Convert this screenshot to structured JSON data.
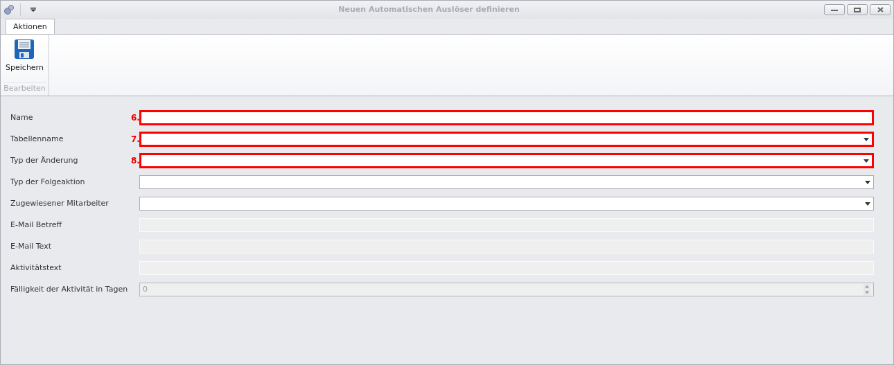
{
  "window": {
    "title": "Neuen Automatischen Auslöser definieren"
  },
  "tabs": [
    {
      "label": "Aktionen",
      "selected": true
    }
  ],
  "ribbon": {
    "buttons": [
      {
        "label": "Speichern"
      }
    ],
    "group": "Bearbeiten"
  },
  "fields": [
    {
      "label": "Name",
      "kind": "text",
      "disabled": false,
      "annotation": "6."
    },
    {
      "label": "Tabellenname",
      "kind": "combo",
      "disabled": false,
      "annotation": "7."
    },
    {
      "label": "Typ der Änderung",
      "kind": "combo",
      "disabled": false,
      "annotation": "8."
    },
    {
      "label": "Typ der Folgeaktion",
      "kind": "combo",
      "disabled": false
    },
    {
      "label": "Zugewiesener Mitarbeiter",
      "kind": "combo",
      "disabled": false
    },
    {
      "label": "E-Mail Betreff",
      "kind": "text",
      "disabled": true
    },
    {
      "label": "E-Mail Text",
      "kind": "text",
      "disabled": true
    },
    {
      "label": "Aktivitätstext",
      "kind": "text",
      "disabled": true
    },
    {
      "label": "Fälligkeit der Aktivität in Tagen",
      "kind": "spin",
      "disabled": true,
      "value": "0"
    }
  ]
}
